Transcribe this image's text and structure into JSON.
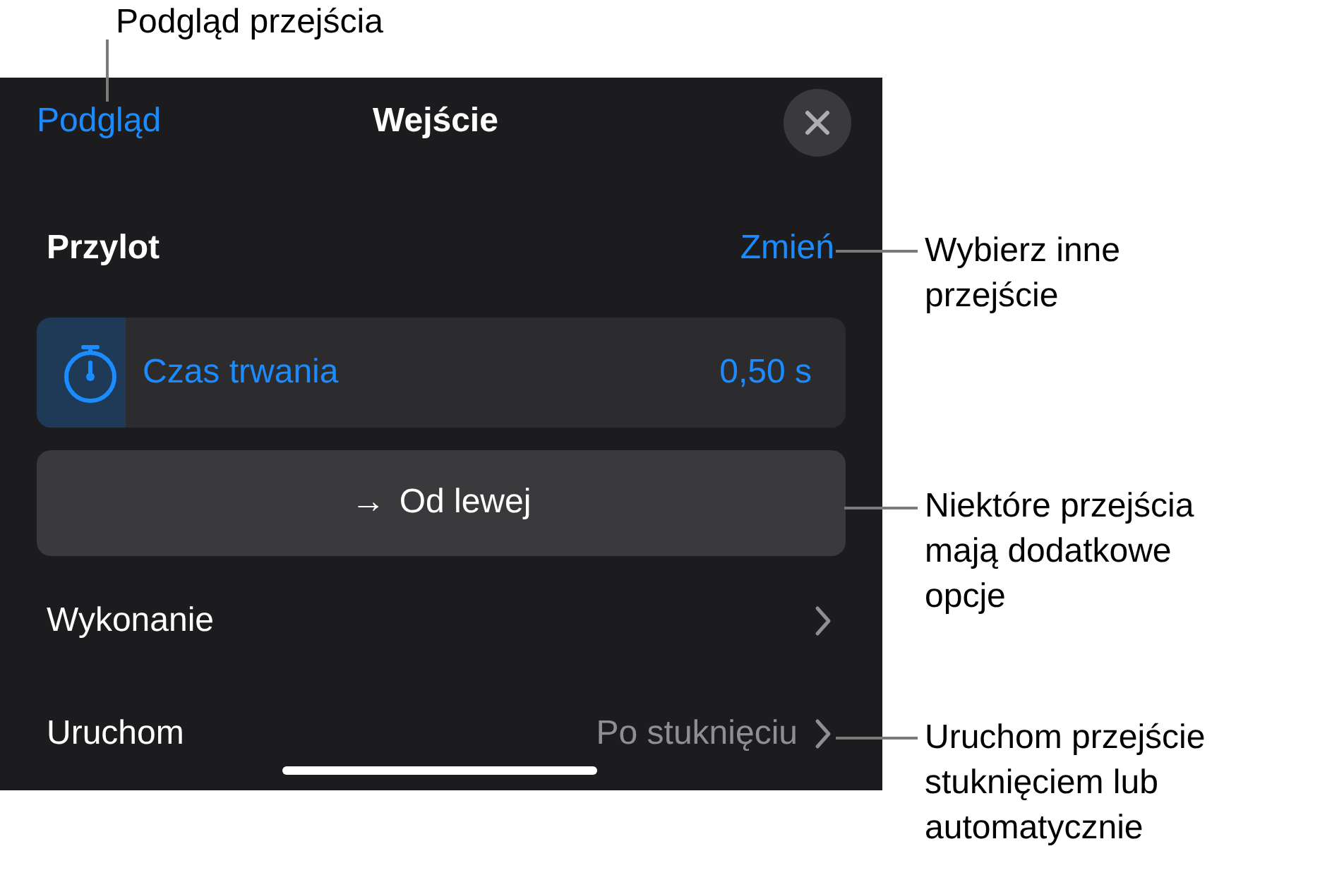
{
  "panel": {
    "back_link": "Podgląd",
    "title": "Wejście",
    "transition": {
      "name": "Przylot",
      "change": "Zmień"
    },
    "duration": {
      "label": "Czas trwania",
      "value": "0,50 s",
      "level": 0.11
    },
    "direction_button": {
      "arrow": "→",
      "label": "Od lewej"
    },
    "rows": [
      {
        "label": "Wykonanie"
      },
      {
        "label": "Uruchom",
        "value": "Po stuknięciu"
      }
    ]
  },
  "callouts": [
    {
      "lines": [
        "Podgląd przejścia"
      ]
    },
    {
      "lines": [
        "Wybierz inne",
        "przejście"
      ]
    },
    {
      "lines": [
        "Niektóre przejścia",
        "mają dodatkowe",
        "opcje"
      ]
    },
    {
      "lines": [
        "Uruchom przejście",
        "stuknięciem lub",
        "automatycznie"
      ]
    }
  ]
}
